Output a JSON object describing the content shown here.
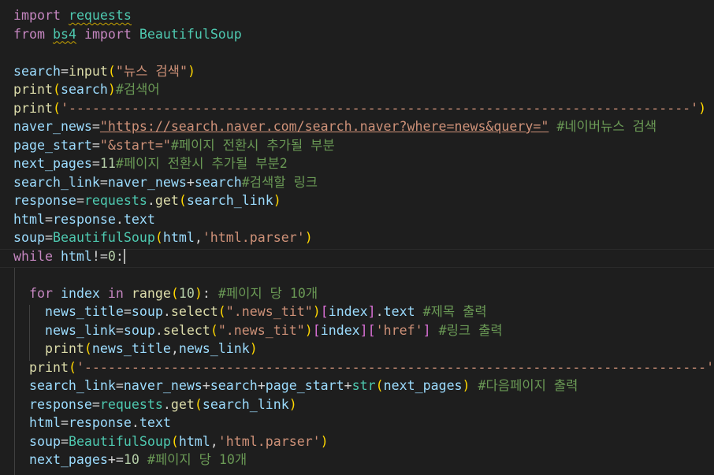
{
  "editor": {
    "lines": [
      [
        {
          "c": "kw-ctl",
          "t": "import"
        },
        {
          "c": "plain",
          "t": " "
        },
        {
          "c": "mod squiggle",
          "t": "requests"
        }
      ],
      [
        {
          "c": "kw-ctl",
          "t": "from"
        },
        {
          "c": "plain",
          "t": " "
        },
        {
          "c": "mod squiggle",
          "t": "bs4"
        },
        {
          "c": "plain",
          "t": " "
        },
        {
          "c": "kw-ctl",
          "t": "import"
        },
        {
          "c": "plain",
          "t": " "
        },
        {
          "c": "cls",
          "t": "BeautifulSoup"
        }
      ],
      [],
      [
        {
          "c": "var",
          "t": "search"
        },
        {
          "c": "plain",
          "t": "="
        },
        {
          "c": "fn",
          "t": "input"
        },
        {
          "c": "brk1",
          "t": "("
        },
        {
          "c": "str",
          "t": "\"뉴스 검색\""
        },
        {
          "c": "brk1",
          "t": ")"
        }
      ],
      [
        {
          "c": "fn",
          "t": "print"
        },
        {
          "c": "brk1",
          "t": "("
        },
        {
          "c": "var",
          "t": "search"
        },
        {
          "c": "brk1",
          "t": ")"
        },
        {
          "c": "cmt",
          "t": "#검색어"
        }
      ],
      [
        {
          "c": "fn",
          "t": "print"
        },
        {
          "c": "brk1",
          "t": "("
        },
        {
          "c": "str",
          "t": "'-------------------------------------------------------------------------------'"
        },
        {
          "c": "brk1",
          "t": ")"
        }
      ],
      [
        {
          "c": "var",
          "t": "naver_news"
        },
        {
          "c": "plain",
          "t": "="
        },
        {
          "c": "str link",
          "t": "\"https://search.naver.com/search.naver?where=news&query=\""
        },
        {
          "c": "plain",
          "t": " "
        },
        {
          "c": "cmt",
          "t": "#네이버뉴스 검색"
        }
      ],
      [
        {
          "c": "var",
          "t": "page_start"
        },
        {
          "c": "plain",
          "t": "="
        },
        {
          "c": "str",
          "t": "\"&start=\""
        },
        {
          "c": "cmt",
          "t": "#페이지 전환시 추가될 부분"
        }
      ],
      [
        {
          "c": "var",
          "t": "next_pages"
        },
        {
          "c": "plain",
          "t": "="
        },
        {
          "c": "num",
          "t": "11"
        },
        {
          "c": "cmt",
          "t": "#페이지 전환시 추가될 부분2"
        }
      ],
      [
        {
          "c": "var",
          "t": "search_link"
        },
        {
          "c": "plain",
          "t": "="
        },
        {
          "c": "var",
          "t": "naver_news"
        },
        {
          "c": "plain",
          "t": "+"
        },
        {
          "c": "var",
          "t": "search"
        },
        {
          "c": "cmt",
          "t": "#검색할 링크"
        }
      ],
      [
        {
          "c": "var",
          "t": "response"
        },
        {
          "c": "plain",
          "t": "="
        },
        {
          "c": "mod",
          "t": "requests"
        },
        {
          "c": "plain",
          "t": "."
        },
        {
          "c": "fn",
          "t": "get"
        },
        {
          "c": "brk1",
          "t": "("
        },
        {
          "c": "var",
          "t": "search_link"
        },
        {
          "c": "brk1",
          "t": ")"
        }
      ],
      [
        {
          "c": "var",
          "t": "html"
        },
        {
          "c": "plain",
          "t": "="
        },
        {
          "c": "var",
          "t": "response"
        },
        {
          "c": "plain",
          "t": "."
        },
        {
          "c": "var",
          "t": "text"
        }
      ],
      [
        {
          "c": "var",
          "t": "soup"
        },
        {
          "c": "plain",
          "t": "="
        },
        {
          "c": "cls",
          "t": "BeautifulSoup"
        },
        {
          "c": "brk1",
          "t": "("
        },
        {
          "c": "var",
          "t": "html"
        },
        {
          "c": "plain",
          "t": ","
        },
        {
          "c": "str",
          "t": "'html.parser'"
        },
        {
          "c": "brk1",
          "t": ")"
        }
      ],
      [
        {
          "c": "kw-ctl",
          "t": "while"
        },
        {
          "c": "plain",
          "t": " "
        },
        {
          "c": "var",
          "t": "html"
        },
        {
          "c": "plain",
          "t": "!="
        },
        {
          "c": "num",
          "t": "0"
        },
        {
          "c": "plain",
          "t": ":"
        },
        {
          "c": "cursor",
          "t": ""
        }
      ],
      [],
      [
        {
          "c": "plain",
          "t": "  "
        },
        {
          "c": "kw-ctl",
          "t": "for"
        },
        {
          "c": "plain",
          "t": " "
        },
        {
          "c": "var",
          "t": "index"
        },
        {
          "c": "plain",
          "t": " "
        },
        {
          "c": "kw-ctl",
          "t": "in"
        },
        {
          "c": "plain",
          "t": " "
        },
        {
          "c": "fn",
          "t": "range"
        },
        {
          "c": "brk1",
          "t": "("
        },
        {
          "c": "num",
          "t": "10"
        },
        {
          "c": "brk1",
          "t": ")"
        },
        {
          "c": "plain",
          "t": ": "
        },
        {
          "c": "cmt",
          "t": "#페이지 당 10개"
        }
      ],
      [
        {
          "c": "plain",
          "t": "    "
        },
        {
          "c": "var",
          "t": "news_title"
        },
        {
          "c": "plain",
          "t": "="
        },
        {
          "c": "var",
          "t": "soup"
        },
        {
          "c": "plain",
          "t": "."
        },
        {
          "c": "fn",
          "t": "select"
        },
        {
          "c": "brk1",
          "t": "("
        },
        {
          "c": "str",
          "t": "\".news_tit\""
        },
        {
          "c": "brk1",
          "t": ")"
        },
        {
          "c": "brk2",
          "t": "["
        },
        {
          "c": "var",
          "t": "index"
        },
        {
          "c": "brk2",
          "t": "]"
        },
        {
          "c": "plain",
          "t": "."
        },
        {
          "c": "var",
          "t": "text"
        },
        {
          "c": "plain",
          "t": " "
        },
        {
          "c": "cmt",
          "t": "#제목 출력"
        }
      ],
      [
        {
          "c": "plain",
          "t": "    "
        },
        {
          "c": "var",
          "t": "news_link"
        },
        {
          "c": "plain",
          "t": "="
        },
        {
          "c": "var",
          "t": "soup"
        },
        {
          "c": "plain",
          "t": "."
        },
        {
          "c": "fn",
          "t": "select"
        },
        {
          "c": "brk1",
          "t": "("
        },
        {
          "c": "str",
          "t": "\".news_tit\""
        },
        {
          "c": "brk1",
          "t": ")"
        },
        {
          "c": "brk2",
          "t": "["
        },
        {
          "c": "var",
          "t": "index"
        },
        {
          "c": "brk2",
          "t": "]"
        },
        {
          "c": "brk2",
          "t": "["
        },
        {
          "c": "str",
          "t": "'href'"
        },
        {
          "c": "brk2",
          "t": "]"
        },
        {
          "c": "plain",
          "t": " "
        },
        {
          "c": "cmt",
          "t": "#링크 출력"
        }
      ],
      [
        {
          "c": "plain",
          "t": "    "
        },
        {
          "c": "fn",
          "t": "print"
        },
        {
          "c": "brk1",
          "t": "("
        },
        {
          "c": "var",
          "t": "news_title"
        },
        {
          "c": "plain",
          "t": ","
        },
        {
          "c": "var",
          "t": "news_link"
        },
        {
          "c": "brk1",
          "t": ")"
        }
      ],
      [
        {
          "c": "plain",
          "t": "  "
        },
        {
          "c": "fn",
          "t": "print"
        },
        {
          "c": "brk1",
          "t": "("
        },
        {
          "c": "str",
          "t": "'-------------------------------------------------------------------------------'"
        },
        {
          "c": "brk1",
          "t": ")"
        }
      ],
      [
        {
          "c": "plain",
          "t": "  "
        },
        {
          "c": "var",
          "t": "search_link"
        },
        {
          "c": "plain",
          "t": "="
        },
        {
          "c": "var",
          "t": "naver_news"
        },
        {
          "c": "plain",
          "t": "+"
        },
        {
          "c": "var",
          "t": "search"
        },
        {
          "c": "plain",
          "t": "+"
        },
        {
          "c": "var",
          "t": "page_start"
        },
        {
          "c": "plain",
          "t": "+"
        },
        {
          "c": "cls",
          "t": "str"
        },
        {
          "c": "brk1",
          "t": "("
        },
        {
          "c": "var",
          "t": "next_pages"
        },
        {
          "c": "brk1",
          "t": ")"
        },
        {
          "c": "plain",
          "t": " "
        },
        {
          "c": "cmt",
          "t": "#다음페이지 출력"
        }
      ],
      [
        {
          "c": "plain",
          "t": "  "
        },
        {
          "c": "var",
          "t": "response"
        },
        {
          "c": "plain",
          "t": "="
        },
        {
          "c": "mod",
          "t": "requests"
        },
        {
          "c": "plain",
          "t": "."
        },
        {
          "c": "fn",
          "t": "get"
        },
        {
          "c": "brk1",
          "t": "("
        },
        {
          "c": "var",
          "t": "search_link"
        },
        {
          "c": "brk1",
          "t": ")"
        }
      ],
      [
        {
          "c": "plain",
          "t": "  "
        },
        {
          "c": "var",
          "t": "html"
        },
        {
          "c": "plain",
          "t": "="
        },
        {
          "c": "var",
          "t": "response"
        },
        {
          "c": "plain",
          "t": "."
        },
        {
          "c": "var",
          "t": "text"
        }
      ],
      [
        {
          "c": "plain",
          "t": "  "
        },
        {
          "c": "var",
          "t": "soup"
        },
        {
          "c": "plain",
          "t": "="
        },
        {
          "c": "cls",
          "t": "BeautifulSoup"
        },
        {
          "c": "brk1",
          "t": "("
        },
        {
          "c": "var",
          "t": "html"
        },
        {
          "c": "plain",
          "t": ","
        },
        {
          "c": "str",
          "t": "'html.parser'"
        },
        {
          "c": "brk1",
          "t": ")"
        }
      ],
      [
        {
          "c": "plain",
          "t": "  "
        },
        {
          "c": "var",
          "t": "next_pages"
        },
        {
          "c": "plain",
          "t": "+="
        },
        {
          "c": "num",
          "t": "10"
        },
        {
          "c": "plain",
          "t": " "
        },
        {
          "c": "cmt",
          "t": "#페이지 당 10개"
        }
      ]
    ]
  }
}
